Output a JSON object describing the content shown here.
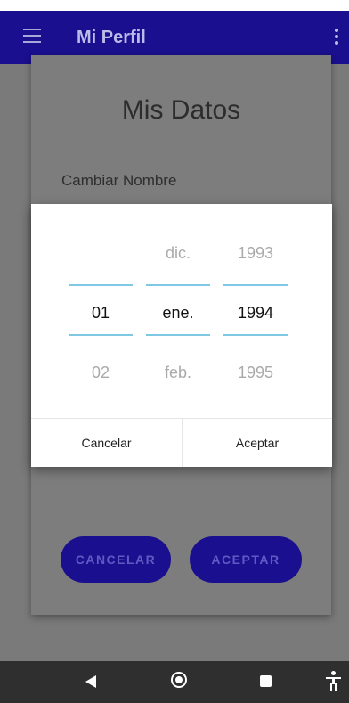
{
  "app_bar": {
    "title": "Mi Perfil",
    "background": "#1a0f8e"
  },
  "profile_card": {
    "title": "Mis Datos",
    "label": "Cambiar Nombre",
    "partial_text": "Nombre",
    "buttons": {
      "cancel": "CANCELAR",
      "accept": "ACEPTAR"
    }
  },
  "date_picker": {
    "accent": "#7ec8e3",
    "day": {
      "prev": "",
      "current": "01",
      "next": "02"
    },
    "month": {
      "prev": "dic.",
      "current": "ene.",
      "next": "feb."
    },
    "year": {
      "prev": "1993",
      "current": "1994",
      "next": "1995"
    },
    "cancel_label": "Cancelar",
    "accept_label": "Aceptar"
  },
  "nav_bar": {
    "icons": [
      "back-icon",
      "home-icon",
      "recent-apps-icon",
      "accessibility-icon"
    ]
  }
}
